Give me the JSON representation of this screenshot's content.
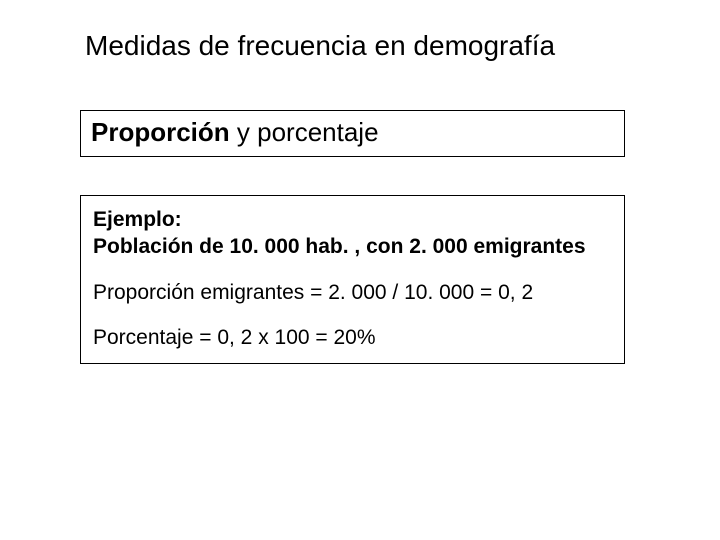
{
  "title": "Medidas de frecuencia en demografía",
  "subtitle": {
    "bold": "Proporción",
    "rest": " y porcentaje"
  },
  "example": {
    "label_ejemplo": "Ejemplo:",
    "label_poblacion": "Población de 10. 000 hab. , con 2. 000 emigrantes",
    "line_proporcion": "Proporción emigrantes = 2. 000 / 10. 000 = 0, 2",
    "line_porcentaje": "Porcentaje = 0, 2 x 100 = 20%"
  }
}
